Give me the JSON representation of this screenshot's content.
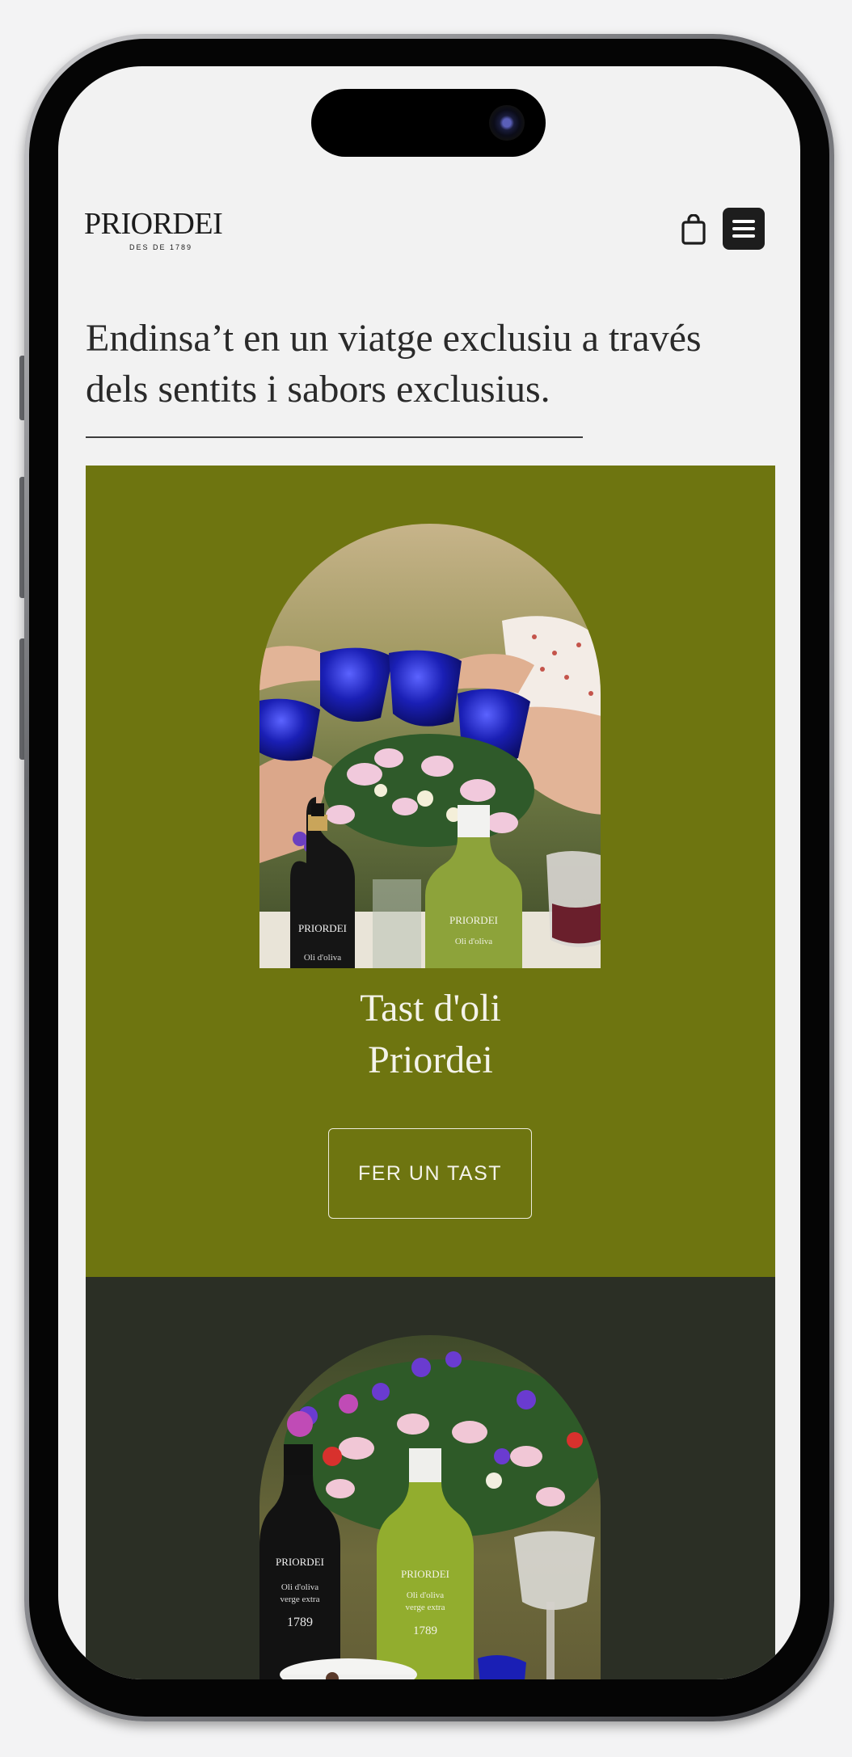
{
  "brand": {
    "name": "PRIORDEI",
    "tagline": "DES DE 1789"
  },
  "header": {
    "cart_icon": "shopping-bag-icon",
    "menu_icon": "hamburger-menu-icon"
  },
  "hero": {
    "headline": "Endinsa’t en un viatge exclusiu a través dels sentits i sabors exclusius."
  },
  "cards": [
    {
      "title_line1": "Tast d'oli",
      "title_line2": "Priordei",
      "cta_label": "FER UN TAST",
      "bg": "#6e7510"
    },
    {
      "bg": "#2b2f25"
    }
  ],
  "bottles": {
    "brand": "PRIORDEI",
    "line1": "Oli d'oliva",
    "line2": "verge extra",
    "year": "1789"
  },
  "colors": {
    "olive": "#6e7510",
    "dark": "#2b2f25",
    "page": "#f2f2f2",
    "glass": "#1a1fa8"
  }
}
